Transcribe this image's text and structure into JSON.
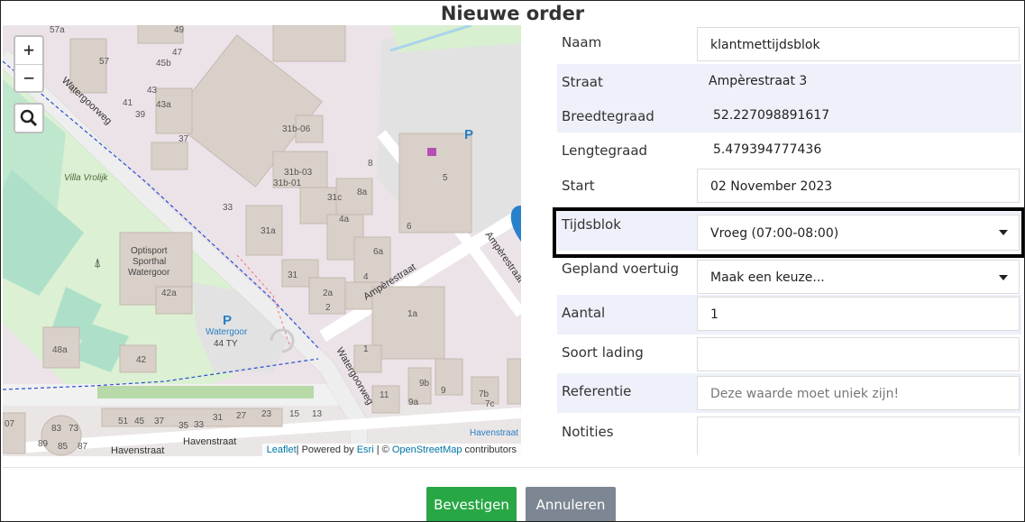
{
  "modal": {
    "title": "Nieuwe order"
  },
  "map": {
    "zoom_in": "+",
    "zoom_out": "−",
    "attribution": {
      "leaflet": "Leaflet",
      "powered": "| Powered by ",
      "esri": "Esri",
      "sep": " | © ",
      "osm": "OpenStreetMap",
      "contributors": " contributors"
    },
    "streets": [
      "Watergoorweg",
      "Watergoorweg",
      "Ampèrestraat",
      "Ampèrestraat",
      "Havenstraat",
      "Havenstraat"
    ],
    "places": [
      "Villa Vrolijk",
      "Optisport",
      "Sporthal",
      "Watergoor",
      "Watergoor",
      "44 TY",
      "Havenstraat"
    ],
    "numbers": [
      "57a",
      "49",
      "47",
      "57",
      "45b",
      "43",
      "43a",
      "41",
      "39",
      "37",
      "31b-06",
      "8",
      "31b-03",
      "31b-01",
      "31c",
      "8a",
      "33",
      "4a",
      "6",
      "31a",
      "6a",
      "31",
      "4",
      "2a",
      "2",
      "42a",
      "1a",
      "48a",
      "42",
      "1",
      "9b",
      "11",
      "9a",
      "9",
      "7b",
      "7c",
      "07",
      "83",
      "73",
      "51",
      "45",
      "37",
      "35",
      "33",
      "31",
      "27",
      "23",
      "15",
      "13",
      "89",
      "85",
      "87",
      "5"
    ]
  },
  "form": {
    "fields": [
      {
        "label": "Naam",
        "value": "klantmettijdsblok"
      },
      {
        "label": "Straat",
        "value": "Ampèrestraat 3"
      },
      {
        "label": "Breedtegraad",
        "value": "52.227098891617"
      },
      {
        "label": "Lengtegraad",
        "value": "5.479394777436"
      },
      {
        "label": "Start",
        "value": "02 November 2023"
      },
      {
        "label": "Tijdsblok",
        "value": "Vroeg (07:00-08:00)"
      },
      {
        "label": "Gepland voertuig",
        "value": "Maak een keuze..."
      },
      {
        "label": "Aantal",
        "value": "1"
      },
      {
        "label": "Soort lading",
        "value": ""
      },
      {
        "label": "Referentie",
        "placeholder": "Deze waarde moet uniek zijn!"
      },
      {
        "label": "Notities",
        "value": ""
      }
    ]
  },
  "buttons": {
    "confirm": "Bevestigen",
    "cancel": "Annuleren"
  },
  "colors": {
    "confirm": "#28a745",
    "cancel": "#7d8793",
    "highlight": "#000000",
    "shaded_row": "#eef1fa"
  }
}
